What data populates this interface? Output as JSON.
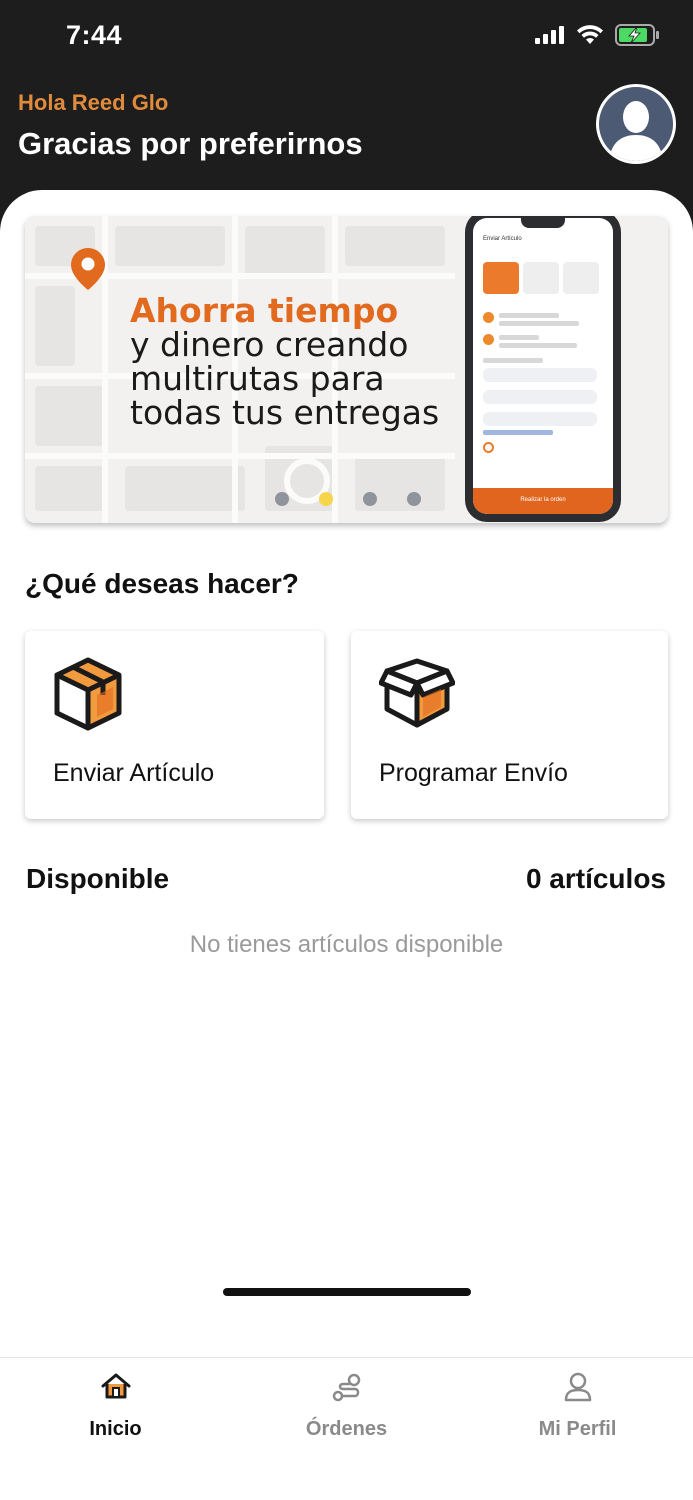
{
  "status_bar": {
    "time": "7:44"
  },
  "header": {
    "greeting": "Hola Reed Glo",
    "subtitle": "Gracias por preferirnos"
  },
  "banner": {
    "highlight": "Ahorra tiempo",
    "lines": [
      "y dinero creando",
      "multirutas para",
      "todas tus entregas"
    ],
    "active_slide": 2,
    "slide_count": 4,
    "phone_title": "Enviar Artículo",
    "phone_button": "Realizar la orden"
  },
  "section": {
    "title": "¿Qué deseas hacer?"
  },
  "actions": [
    {
      "label": "Enviar Artículo",
      "icon": "box-closed-icon"
    },
    {
      "label": "Programar Envío",
      "icon": "box-open-icon"
    }
  ],
  "available": {
    "title": "Disponible",
    "count": "0 artículos",
    "empty_message": "No tienes artículos disponible"
  },
  "bottom_nav": {
    "items": [
      {
        "label": "Inicio",
        "icon": "home-icon",
        "active": true
      },
      {
        "label": "Órdenes",
        "icon": "route-icon",
        "active": false
      },
      {
        "label": "Mi Perfil",
        "icon": "user-icon",
        "active": false
      }
    ]
  },
  "colors": {
    "accent": "#e26a1f",
    "greeting": "#e08a3c",
    "header_bg": "#1d1d1d",
    "dot_active": "#f6d54a"
  }
}
